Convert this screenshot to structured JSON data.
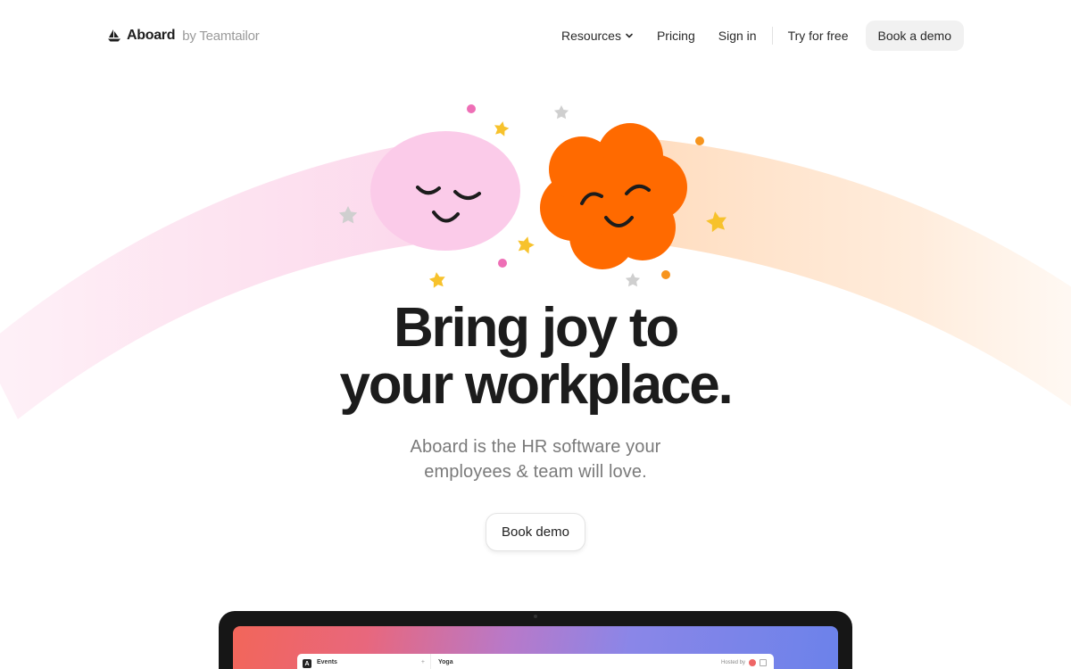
{
  "brand": {
    "name": "Aboard",
    "by": "by Teamtailor"
  },
  "nav": {
    "resources": "Resources",
    "pricing": "Pricing",
    "sign_in": "Sign in",
    "try_free": "Try for free",
    "book_a_demo": "Book a demo"
  },
  "hero": {
    "title_line1": "Bring joy to",
    "title_line2": "your workplace.",
    "subtitle_line1": "Aboard is the HR software your",
    "subtitle_line2": "employees & team will love.",
    "cta": "Book demo"
  },
  "app_preview": {
    "logo_letter": "A",
    "sidebar_title": "Events",
    "add_icon": "+",
    "event_title": "Yoga",
    "hosted_by": "Hosted by"
  },
  "colors": {
    "pink_blob": "#fbcbe9",
    "orange_flower": "#ff6a00",
    "star_yellow": "#f7c22c",
    "star_gray": "#cfcfcf",
    "dot_pink": "#ee6fb6",
    "dot_orange": "#f7941d",
    "text_dark": "#1c1c1c",
    "text_muted": "#7a7a7a"
  },
  "icons": {
    "brand_mark": "sailboat-icon",
    "resources_dropdown": "chevron-down-icon",
    "add": "plus-icon",
    "calendar": "calendar-icon"
  }
}
